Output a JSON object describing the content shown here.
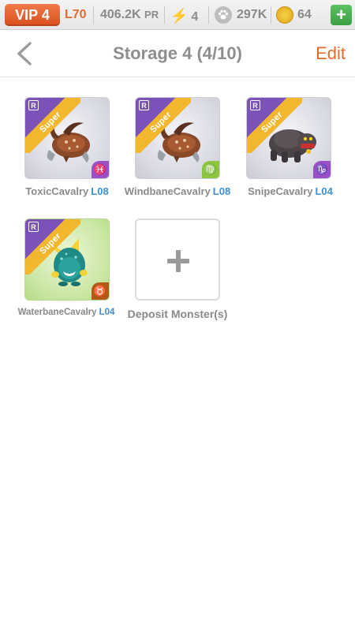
{
  "status_bar": {
    "vip_label": "VIP 4",
    "level": "L70",
    "power_value": "406.2K",
    "power_unit": "PR",
    "energy": "4",
    "paw_count": "297K",
    "coin_count": "64",
    "add_label": "+"
  },
  "header": {
    "title": "Storage 4 (4/10)",
    "edit_label": "Edit"
  },
  "monsters": [
    {
      "name": "ToxicCavalry",
      "level": "L08",
      "rarity": "R",
      "tier": "Super",
      "sign": "♓"
    },
    {
      "name": "WindbaneCavalry",
      "level": "L08",
      "rarity": "R",
      "tier": "Super",
      "sign": "♍"
    },
    {
      "name": "SnipeCavalry",
      "level": "L04",
      "rarity": "R",
      "tier": "Super",
      "sign": "♑"
    },
    {
      "name": "WaterbaneCavalry",
      "level": "L04",
      "rarity": "R",
      "tier": "Super",
      "sign": "♉"
    }
  ],
  "deposit": {
    "label": "Deposit Monster(s)"
  },
  "colors": {
    "accent_orange": "#e26a2c",
    "level_blue": "#3c8fd0",
    "ribbon_gold": "#f2b72e",
    "rarity_purple": "#7b52b8"
  }
}
